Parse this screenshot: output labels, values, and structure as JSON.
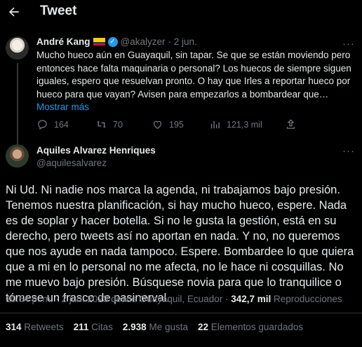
{
  "header": {
    "title": "Tweet",
    "back_icon": "arrow-left-icon"
  },
  "tweet1": {
    "author_name": "André Kang",
    "flag": "🇪🇨",
    "handle": "@akalyzer",
    "date": "· 2 jun.",
    "text": "Mucho hueco aún en Guayaquil, sin tapar. Se que se están moviendo pero entonces hace falta maquinaria o personal? Los huecos de siempre siguen iguales, espero que resuelvan pronto. O hay que Irles a reportar hueco por hueco para que vayan?  Avisen para empezarlos a bombardear que…",
    "show_more": "Mostrar más",
    "replies": "164",
    "retweets": "70",
    "likes": "195",
    "views": "121,3 mil"
  },
  "tweet2": {
    "author_name": "Aquiles Alvarez Henriques",
    "handle": "@aquilesalvarez",
    "text": "Ni Ud. Ni nadie nos marca la agenda, ni trabajamos bajo presión. Tenemos nuestra planificación, si hay mucho hueco, espere. Nada es de soplar y hacer botella. Si no le gusta la gestión, está en su derecho, pero tweets así no aportan en nada. Y no, no queremos que nos ayude en nada tampoco. Espere. Bombardee lo que quiera que a mi en lo personal no me afecta, no le hace ni cosquillas. No me muevo bajo presión. Búsquese novia para que lo tranquilice o tómese un frasco de pasinerval.",
    "timestamp": "10:54 p. m. · 2 jun. 2023 desde Guayaquil, Ecuador ·",
    "views_count": "342,7 mil",
    "views_label": "Reproducciones"
  },
  "stats": {
    "retweets_count": "314",
    "retweets_label": "Retweets",
    "quotes_count": "211",
    "quotes_label": "Citas",
    "likes_count": "2.938",
    "likes_label": "Me gusta",
    "bookmarks_count": "22",
    "bookmarks_label": "Elementos guardados"
  },
  "colors": {
    "background": "#000000",
    "text": "#e7e9ea",
    "muted": "#71767b",
    "accent": "#1d9bf0",
    "border": "#2f3336"
  }
}
